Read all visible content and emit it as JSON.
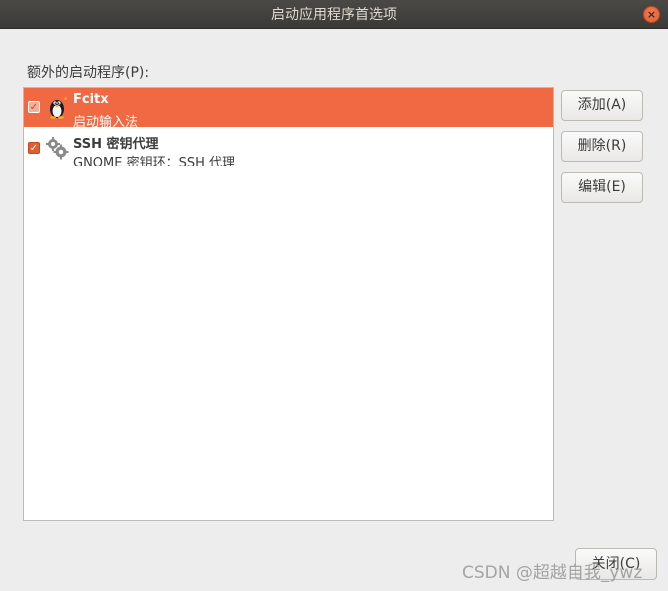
{
  "window": {
    "title": "启动应用程序首选项",
    "close_glyph": "×"
  },
  "section_label": "额外的启动程序(P):",
  "startup_programs": [
    {
      "name": "Fcitx",
      "description": "启动输入法",
      "checked": true,
      "selected": true,
      "icon": "tux-icon"
    },
    {
      "name": "SSH 密钥代理",
      "description": "GNOME 密钥环：SSH 代理",
      "checked": true,
      "selected": false,
      "icon": "gears-icon"
    }
  ],
  "buttons": {
    "add": "添加(A)",
    "remove": "删除(R)",
    "edit": "编辑(E)",
    "close": "关闭(C)"
  },
  "watermark": "CSDN @超越自我_ywz",
  "colors": {
    "selection": "#f06943",
    "accent": "#e35e2f",
    "titlebar": "#3b3a36"
  }
}
